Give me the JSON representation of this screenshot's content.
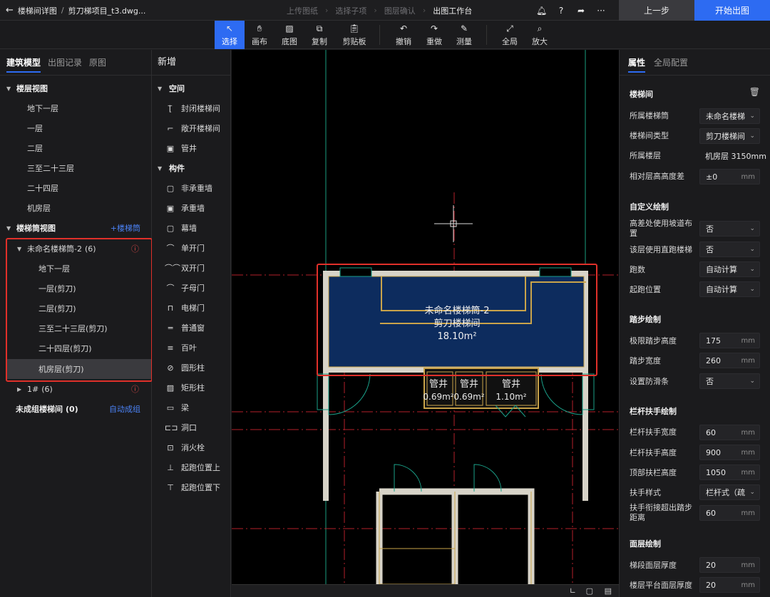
{
  "topbar": {
    "back_label": "楼梯间详图",
    "project_label": "剪刀梯项目_t3.dwg...",
    "steps": [
      "上传图纸",
      "选择子项",
      "图层确认",
      "出图工作台"
    ],
    "prev_button": "上一步",
    "start_button": "开始出图"
  },
  "toolbar": {
    "tools": [
      "选择",
      "画布",
      "底图",
      "复制",
      "剪贴板",
      "撤销",
      "重做",
      "测量",
      "全局",
      "放大"
    ]
  },
  "left": {
    "tabs": [
      "建筑模型",
      "出图记录",
      "原图"
    ],
    "floor_view_title": "楼层视图",
    "floors": [
      "地下一层",
      "一层",
      "二层",
      "三至二十三层",
      "二十四层",
      "机房层"
    ],
    "stair_view_title": "楼梯筒视图",
    "add_stair_link": "+楼梯筒",
    "group1_name": "未命名楼梯筒-2",
    "group1_count": "(6)",
    "group1_items": [
      "地下一层",
      "一层(剪刀)",
      "二层(剪刀)",
      "三至二十三层(剪刀)",
      "二十四层(剪刀)",
      "机房层(剪刀)"
    ],
    "group2_name": "1#",
    "group2_count": "(6)",
    "ungrouped_label": "未成组楼梯间",
    "ungrouped_count": "(0)",
    "auto_group_link": "自动成组"
  },
  "newpanel": {
    "title": "新增",
    "space_title": "空间",
    "space_items": [
      "封闭楼梯间",
      "敞开楼梯间",
      "管井"
    ],
    "component_title": "构件",
    "component_items": [
      "非承重墙",
      "承重墙",
      "幕墙",
      "单开门",
      "双开门",
      "子母门",
      "电梯门",
      "普通窗",
      "百叶",
      "圆形柱",
      "矩形柱",
      "梁",
      "洞口",
      "消火栓",
      "起跑位置上",
      "起跑位置下"
    ]
  },
  "canvas": {
    "stair_name": "未命名楼梯筒-2",
    "stair_type": "剪刀楼梯间",
    "stair_area": "18.10m²",
    "shafts": [
      {
        "label": "管井",
        "area": "0.69m²"
      },
      {
        "label": "管井",
        "area": "0.69m²"
      },
      {
        "label": "管井",
        "area": "1.10m²"
      }
    ]
  },
  "right": {
    "tabs": [
      "属性",
      "全局配置"
    ],
    "section_stair": "楼梯间",
    "props_stair": [
      {
        "label": "所属楼梯筒",
        "value": "未命名楼梯",
        "kind": "select"
      },
      {
        "label": "楼梯间类型",
        "value": "剪刀楼梯间",
        "kind": "select"
      },
      {
        "label": "所属楼层",
        "value": "机房层 3150mm",
        "kind": "text"
      },
      {
        "label": "相对层高高度差",
        "value": "±0",
        "unit": "mm",
        "kind": "input"
      }
    ],
    "section_custom": "自定义绘制",
    "props_custom": [
      {
        "label": "高差处使用坡道布置",
        "value": "否",
        "kind": "select"
      },
      {
        "label": "该层使用直跑楼梯",
        "value": "否",
        "kind": "select"
      },
      {
        "label": "跑数",
        "value": "自动计算",
        "kind": "select"
      },
      {
        "label": "起跑位置",
        "value": "自动计算",
        "kind": "select"
      }
    ],
    "section_step": "踏步绘制",
    "props_step": [
      {
        "label": "极限踏步高度",
        "value": "175",
        "unit": "mm",
        "kind": "input"
      },
      {
        "label": "踏步宽度",
        "value": "260",
        "unit": "mm",
        "kind": "input"
      },
      {
        "label": "设置防滑条",
        "value": "否",
        "kind": "select"
      }
    ],
    "section_rail": "栏杆扶手绘制",
    "props_rail": [
      {
        "label": "栏杆扶手宽度",
        "value": "60",
        "unit": "mm",
        "kind": "input"
      },
      {
        "label": "栏杆扶手高度",
        "value": "900",
        "unit": "mm",
        "kind": "input"
      },
      {
        "label": "顶部扶栏高度",
        "value": "1050",
        "unit": "mm",
        "kind": "input"
      },
      {
        "label": "扶手样式",
        "value": "栏杆式（疏",
        "kind": "select"
      },
      {
        "label": "扶手衔接超出踏步距离",
        "value": "60",
        "unit": "mm",
        "kind": "input"
      }
    ],
    "section_surface": "面层绘制",
    "props_surface": [
      {
        "label": "梯段面层厚度",
        "value": "20",
        "unit": "mm",
        "kind": "input"
      },
      {
        "label": "楼层平台面层厚度",
        "value": "20",
        "unit": "mm",
        "kind": "input"
      }
    ]
  },
  "colors": {
    "accent": "#2d6bf2",
    "highlight": "#e0302a",
    "stair_fill": "#0d2c5e",
    "warning": "#e34a4a"
  }
}
